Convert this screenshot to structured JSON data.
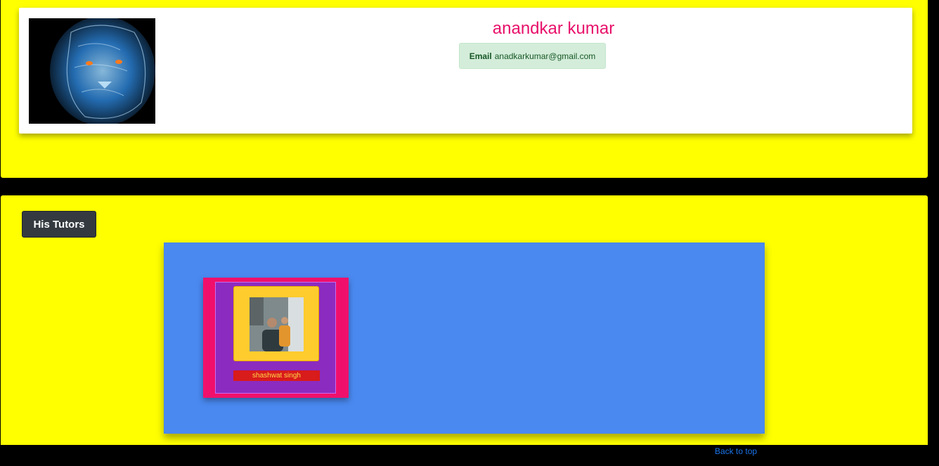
{
  "profile": {
    "name": "anandkar kumar",
    "email_label": "Email",
    "email_value": "anadkarkumar@gmail.com"
  },
  "tutors_section": {
    "heading_button": "His Tutors",
    "tutors": [
      {
        "name": "shashwat singh"
      }
    ]
  },
  "footer": {
    "back_to_top": "Back to top"
  },
  "colors": {
    "page_background": "#000000",
    "panel_background": "#ffff00",
    "name_color": "#e8116b",
    "tutors_area": "#4a89f0",
    "tutor_card_outer": "#f0106b",
    "tutor_card_inner": "#8c2bbf",
    "tutor_photo_frame": "#ffcc2e",
    "tutor_name_bg": "#d81b1b",
    "link": "#1a73e8"
  },
  "icons": {
    "profile_avatar": "lion-portrait-image",
    "tutor_photo": "tutor-photo-image"
  }
}
